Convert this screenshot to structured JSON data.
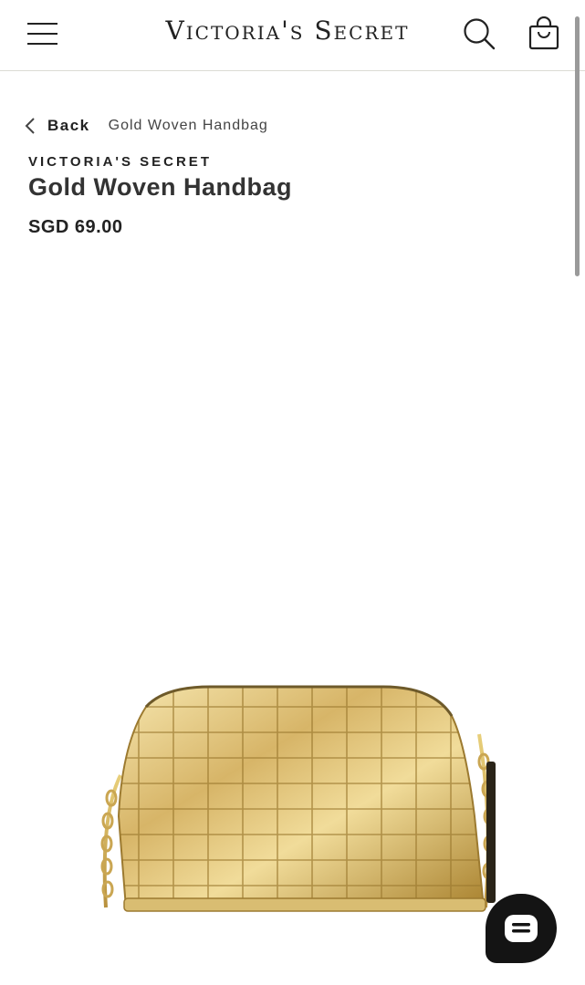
{
  "header": {
    "logo_text": "Victoria's Secret",
    "menu_icon": "hamburger-menu-icon",
    "search_icon": "search-icon",
    "bag_icon": "shopping-bag-icon"
  },
  "breadcrumb": {
    "back_label": "Back",
    "back_icon": "chevron-left-icon",
    "current": "Gold Woven Handbag"
  },
  "product": {
    "brand": "VICTORIA'S SECRET",
    "name": "Gold Woven Handbag",
    "price": "SGD 69.00",
    "image_icon": "gold-woven-handbag-image"
  },
  "chat": {
    "icon": "chat-bubble-icon",
    "color": "#141414"
  },
  "colors": {
    "text": "#222222",
    "divider": "#dcdcd4",
    "gold_light": "#f3e2a6",
    "gold_dark": "#b8913e"
  }
}
